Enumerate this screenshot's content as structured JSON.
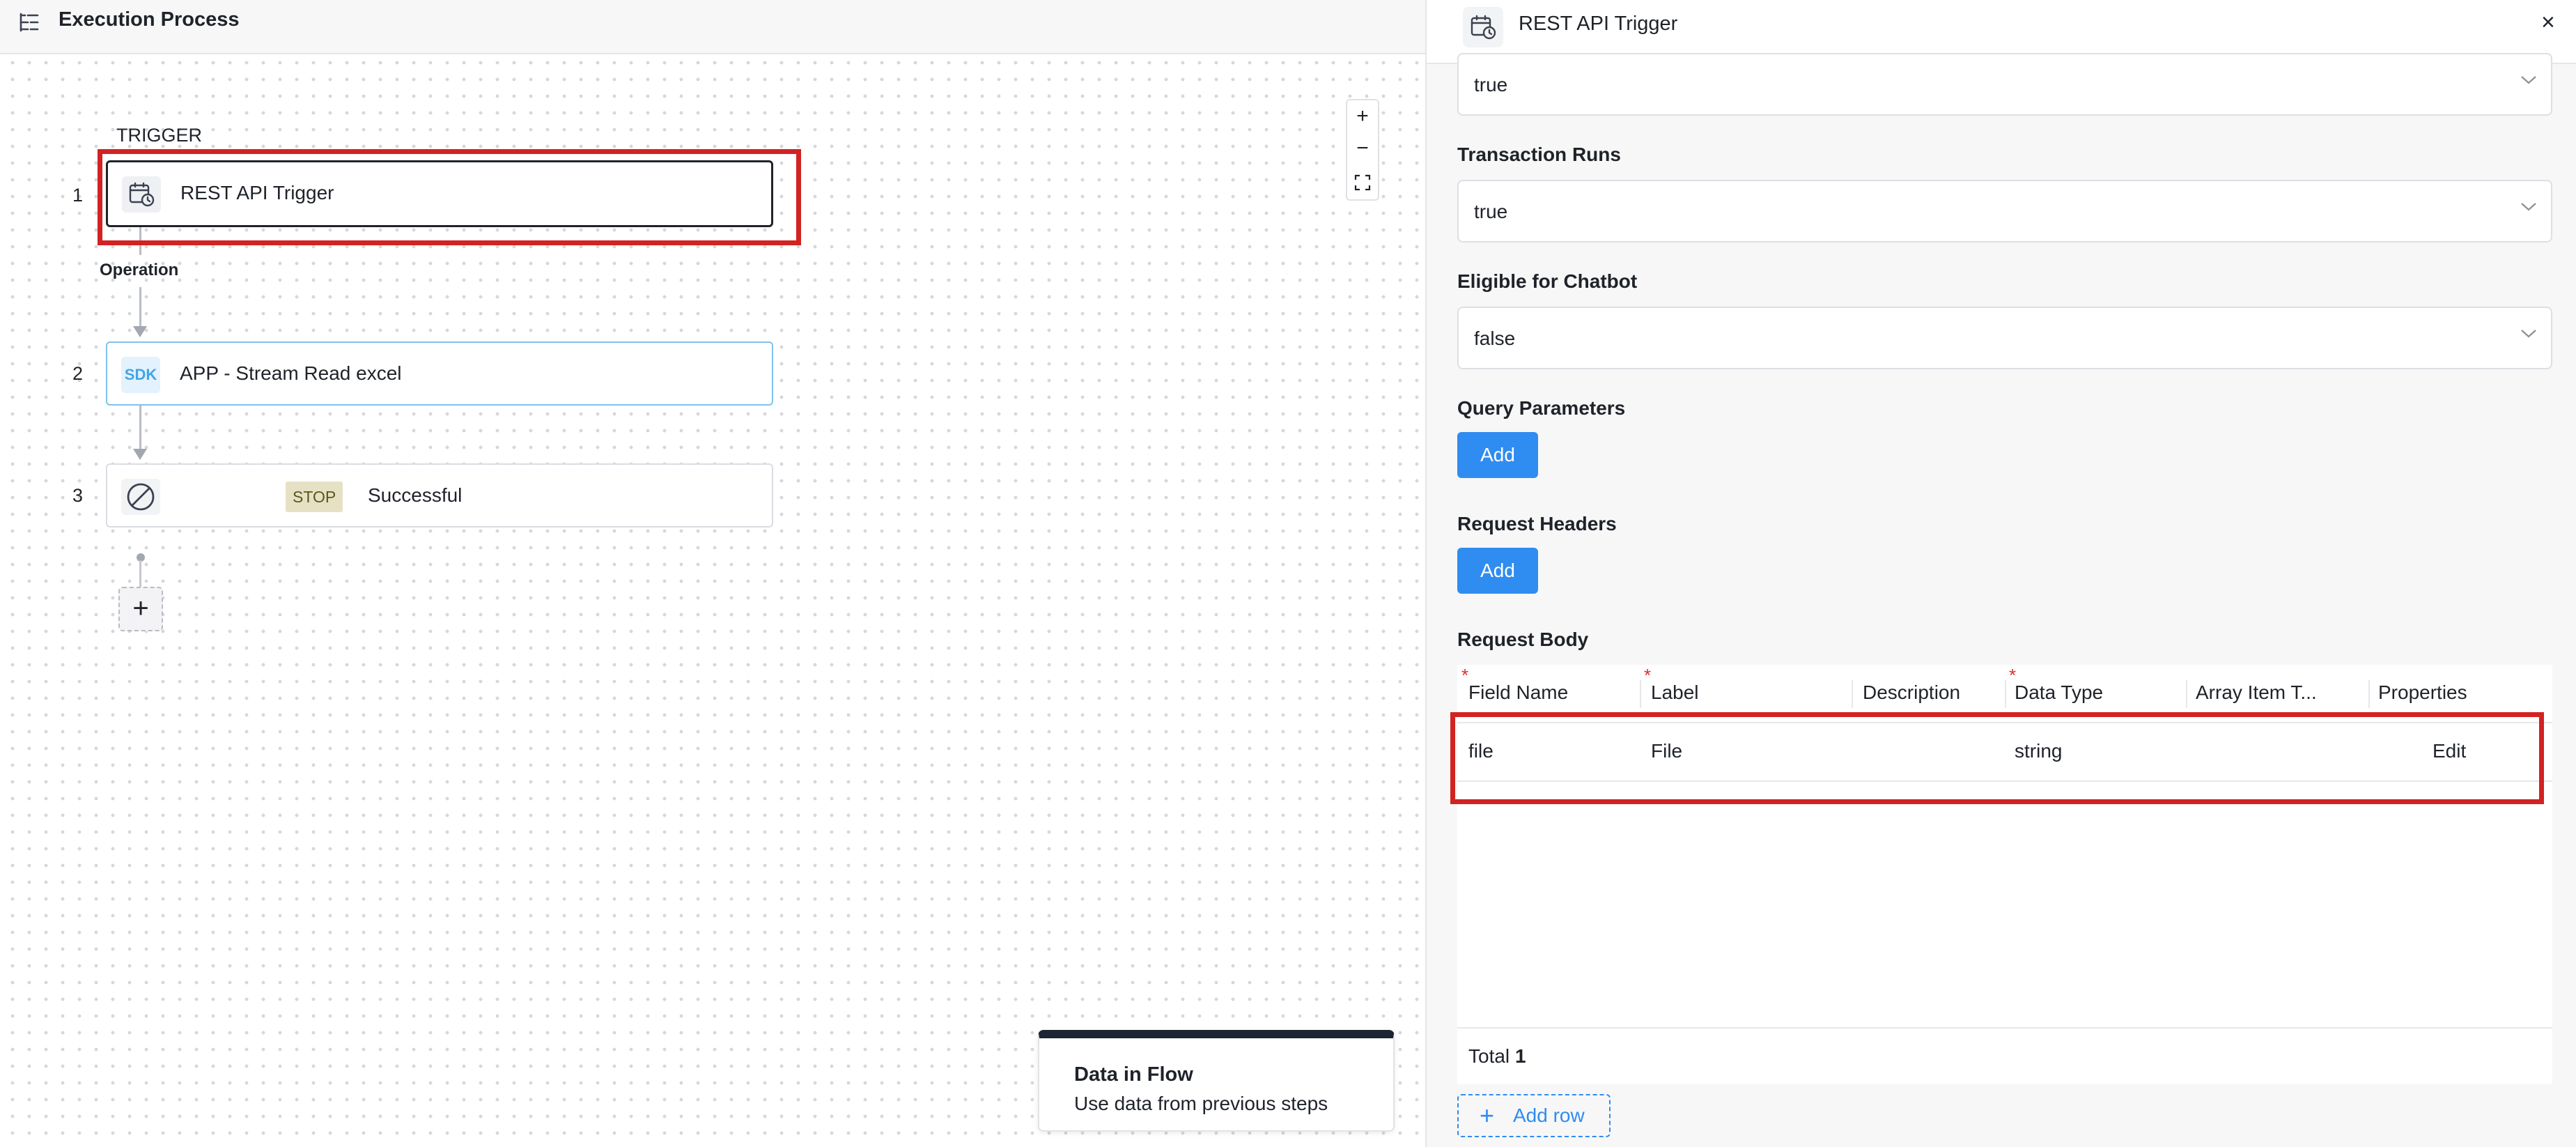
{
  "header": {
    "title": "Execution Process",
    "icon": "flow-list-icon"
  },
  "canvas": {
    "trigger_label": "TRIGGER",
    "operation_label": "Operation",
    "steps": [
      {
        "number": "1",
        "label": "REST API Trigger",
        "icon": "calendar-clock-icon"
      },
      {
        "number": "2",
        "label": "APP - Stream Read excel",
        "icon_text": "SDK"
      },
      {
        "number": "3",
        "label": "Successful",
        "badge": "STOP",
        "icon": "stop-circle-icon"
      }
    ],
    "add_step": "+",
    "zoom": {
      "in": "+",
      "out": "−",
      "fit": "fit-screen-icon"
    },
    "data_in_flow": {
      "title": "Data in Flow",
      "description": "Use data from previous steps"
    }
  },
  "panel": {
    "title": "REST API Trigger",
    "close": "×",
    "first_select_value": "true",
    "fields": [
      {
        "label": "Transaction Runs",
        "value": "true"
      },
      {
        "label": "Eligible for Chatbot",
        "value": "false"
      }
    ],
    "query_parameters": {
      "label": "Query Parameters",
      "button": "Add"
    },
    "request_headers": {
      "label": "Request Headers",
      "button": "Add"
    },
    "request_body": {
      "label": "Request Body",
      "columns": [
        "Field Name",
        "Label",
        "Description",
        "Data Type",
        "Array Item T...",
        "Properties"
      ],
      "required_columns": [
        "Field Name",
        "Label",
        "Data Type"
      ],
      "rows": [
        {
          "field_name": "file",
          "label": "File",
          "description": "",
          "data_type": "string",
          "array_item_type": "",
          "properties": "Edit"
        }
      ],
      "total_label": "Total",
      "total_count": "1",
      "add_row": "Add row"
    }
  },
  "colors": {
    "accent": "#2f8cf0",
    "highlight": "#d22222",
    "sdk_blue": "#42a5e6",
    "stop_badge": "#e6e1c4"
  }
}
